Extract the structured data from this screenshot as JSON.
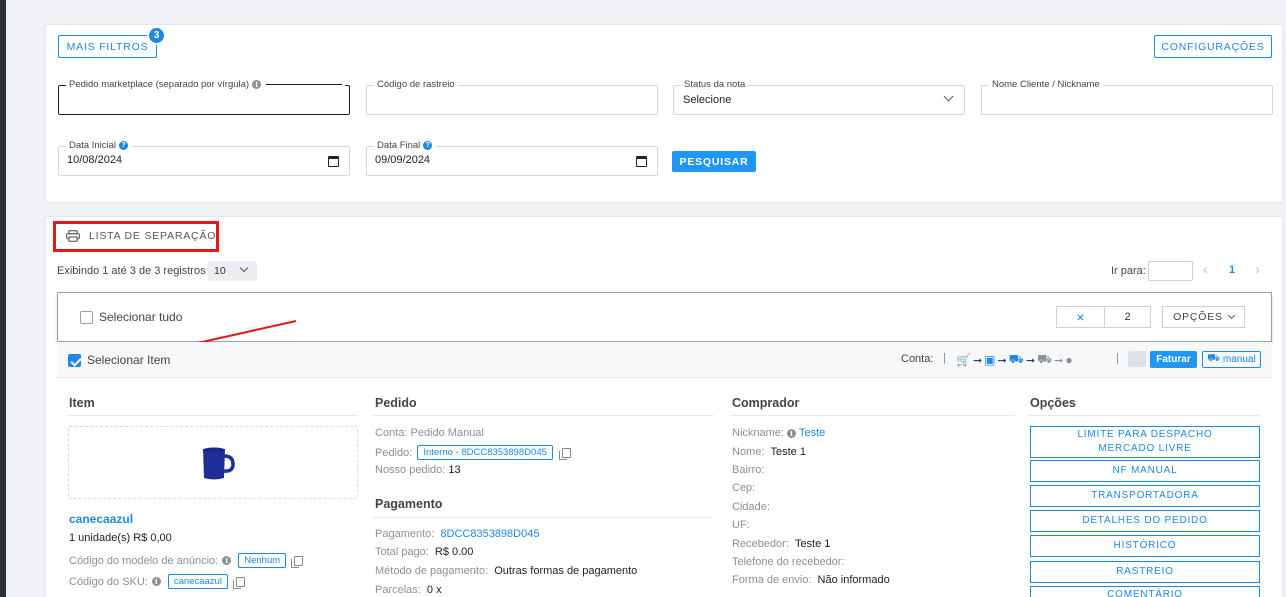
{
  "filters": {
    "more_filters_label": "MAIS FILTROS",
    "more_filters_count": "3",
    "settings_label": "CONFIGURAÇÕES",
    "marketplace_order_label": "Pedido marketplace (separado por vírgula)",
    "marketplace_order_value": "",
    "tracking_label": "Código de rastreio",
    "tracking_value": "",
    "invoice_status_label": "Status da nota",
    "invoice_status_value": "Selecione",
    "client_label": "Nome Cliente / Nickname",
    "client_value": "",
    "start_date_label": "Data Inicial",
    "start_date_value": "10/08/2024",
    "end_date_label": "Data Final",
    "end_date_value": "09/09/2024",
    "search_label": "PESQUISAR"
  },
  "list": {
    "separation_list_label": "LISTA DE SEPARAÇÃO",
    "showing_text": "Exibindo 1 até 3 de 3 registros",
    "page_size": "10",
    "goto_label": "Ir para:",
    "goto_value": "",
    "prev_symbol": "‹",
    "current_page": "1",
    "next_symbol": "›"
  },
  "toolbar": {
    "select_all_label": "Selecionar tudo",
    "clear_symbol": "×",
    "selected_count": "2",
    "options_label": "OPÇÕES"
  },
  "order": {
    "select_item_label": "Selecionar Item",
    "select_item_checked": true,
    "account_label": "Conta:",
    "separator": "|",
    "invoice_button": "Faturar",
    "manual_label": "manual",
    "flow_icons": [
      "cart-icon",
      "boxes-icon",
      "dolly-icon",
      "truck-icon",
      "check-circle-icon"
    ],
    "item": {
      "section_title": "Item",
      "product_name": "canecaazul",
      "quantity_price": "1 unidade(s) R$ 0,00",
      "ad_model_label": "Código do modelo de anúncio:",
      "ad_model_value": "Nenhum",
      "sku_label": "Código do SKU:",
      "sku_value": "canecaazul"
    },
    "pedido": {
      "section_title": "Pedido",
      "account_label": "Conta:",
      "account_value": "Pedido Manual",
      "order_label": "Pedido:",
      "order_value": "Interno - 8DCC8353898D045",
      "our_order_label": "Nosso pedido:",
      "our_order_value": "13"
    },
    "pagamento": {
      "section_title": "Pagamento",
      "payment_label": "Pagamento:",
      "payment_value": "8DCC8353898D045",
      "total_label": "Total pago:",
      "total_value": "R$ 0.00",
      "method_label": "Método de pagamento:",
      "method_value": "Outras formas de pagamento",
      "installments_label": "Parcelas:",
      "installments_value": "0 x"
    },
    "comprador": {
      "section_title": "Comprador",
      "nickname_label": "Nickname:",
      "nickname_value": "Teste",
      "name_label": "Nome:",
      "name_value": "Teste 1",
      "district_label": "Bairro:",
      "zip_label": "Cep:",
      "city_label": "Cidade:",
      "state_label": "UF:",
      "receiver_label": "Recebedor:",
      "receiver_value": "Teste 1",
      "receiver_phone_label": "Telefone do recebedor:",
      "shipping_label": "Forma de envio:",
      "shipping_value": "Não informado"
    },
    "opcoes": {
      "section_title": "Opções",
      "buttons": [
        "LIMITE PARA DESPACHO MERCADO LIVRE",
        "NF MANUAL",
        "TRANSPORTADORA",
        "DETALHES DO PEDIDO",
        "HISTÓRICO",
        "RASTREIO",
        "COMENTÁRIO"
      ]
    }
  },
  "colors": {
    "accent": "#1e88e5",
    "highlight_red": "#e01a1a"
  }
}
